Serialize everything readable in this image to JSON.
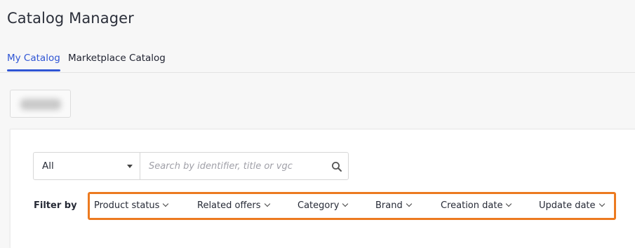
{
  "header": {
    "title": "Catalog Manager"
  },
  "tabs": [
    {
      "label": "My Catalog",
      "active": true
    },
    {
      "label": "Marketplace Catalog",
      "active": false
    }
  ],
  "search": {
    "scope_selected": "All",
    "placeholder": "Search by identifier, title or vgc",
    "value": ""
  },
  "filters": {
    "label": "Filter by",
    "items": [
      {
        "label": "Product status"
      },
      {
        "label": "Related offers"
      },
      {
        "label": "Category"
      },
      {
        "label": "Brand"
      },
      {
        "label": "Creation date"
      },
      {
        "label": "Update date"
      }
    ]
  },
  "colors": {
    "accent": "#2f55d4",
    "highlight": "#ec7a20"
  }
}
